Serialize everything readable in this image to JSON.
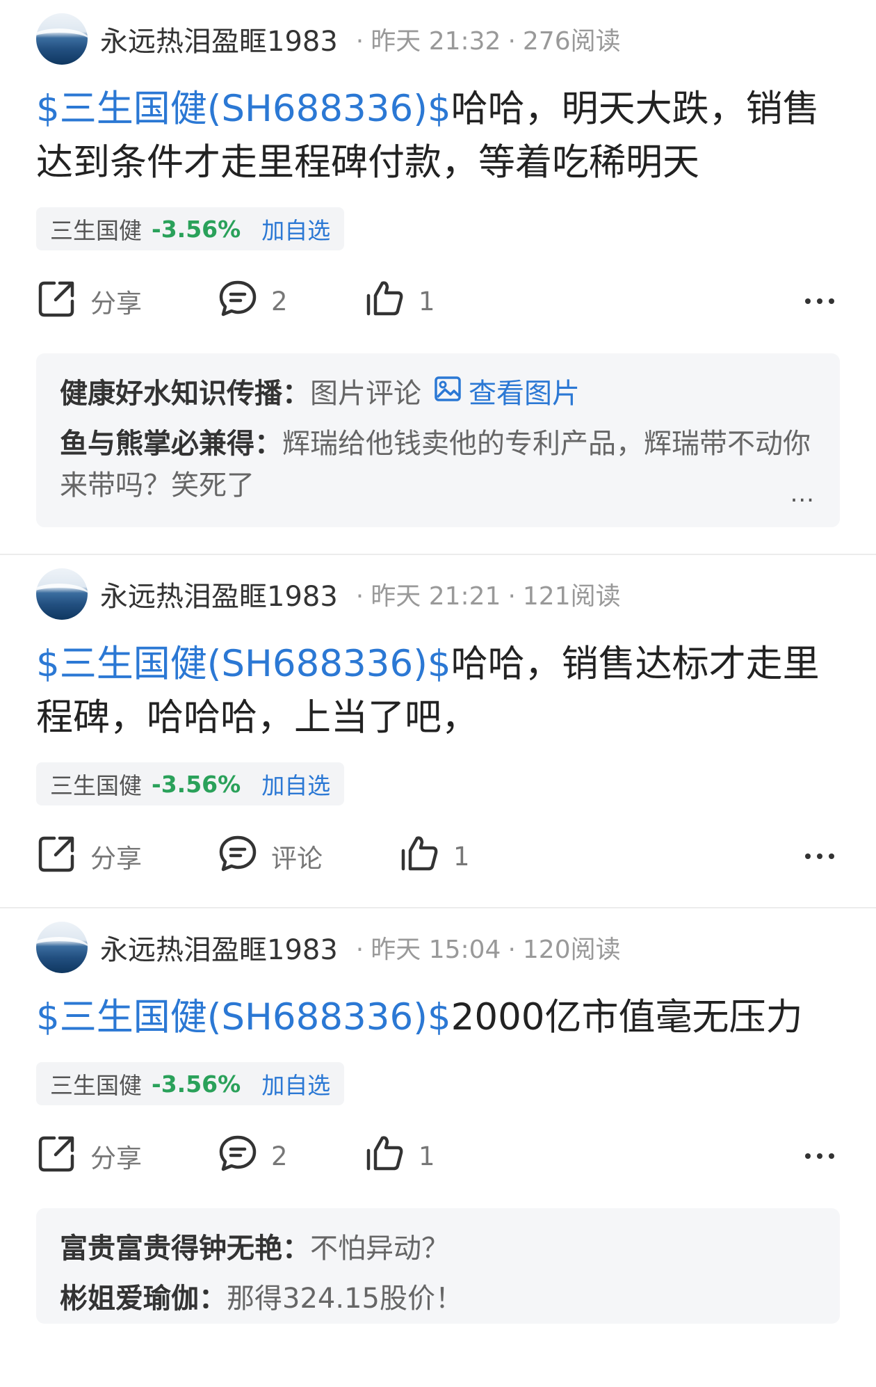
{
  "posts": [
    {
      "author": "永远热泪盈眶1983",
      "time": "昨天 21:32",
      "reads": "276阅读",
      "stock_tag": "$三生国健(SH688336)$",
      "text": "哈哈，明天大跌，销售达到条件才走里程碑付款，等着吃稀明天",
      "chip": {
        "name": "三生国健",
        "change": "-3.56%",
        "add": "加自选"
      },
      "actions": {
        "share": "分享",
        "comment": "2",
        "like": "1"
      },
      "comments": [
        {
          "user": "健康好水知识传播：",
          "text": "图片评论",
          "link": "查看图片"
        },
        {
          "user": "鱼与熊掌必兼得：",
          "text": "辉瑞给他钱卖他的专利产品，辉瑞带不动你来带吗？笑死了"
        }
      ],
      "ellipsis": "..."
    },
    {
      "author": "永远热泪盈眶1983",
      "time": "昨天 21:21",
      "reads": "121阅读",
      "stock_tag": "$三生国健(SH688336)$",
      "text": "哈哈，销售达标才走里程碑，哈哈哈，上当了吧，",
      "chip": {
        "name": "三生国健",
        "change": "-3.56%",
        "add": "加自选"
      },
      "actions": {
        "share": "分享",
        "comment": "评论",
        "like": "1"
      }
    },
    {
      "author": "永远热泪盈眶1983",
      "time": "昨天 15:04",
      "reads": "120阅读",
      "stock_tag": "$三生国健(SH688336)$",
      "text": "2000亿市值毫无压力",
      "chip": {
        "name": "三生国健",
        "change": "-3.56%",
        "add": "加自选"
      },
      "actions": {
        "share": "分享",
        "comment": "2",
        "like": "1"
      },
      "comments": [
        {
          "user": "富贵富贵得钟无艳：",
          "text": "不怕异动？"
        },
        {
          "user": "彬姐爱瑜伽：",
          "text": "那得324.15股价！"
        }
      ]
    }
  ],
  "colors": {
    "link": "#2b78d4",
    "down": "#2aa15a"
  },
  "icons": [
    "share-icon",
    "comment-icon",
    "like-icon",
    "more-icon",
    "image-icon"
  ]
}
